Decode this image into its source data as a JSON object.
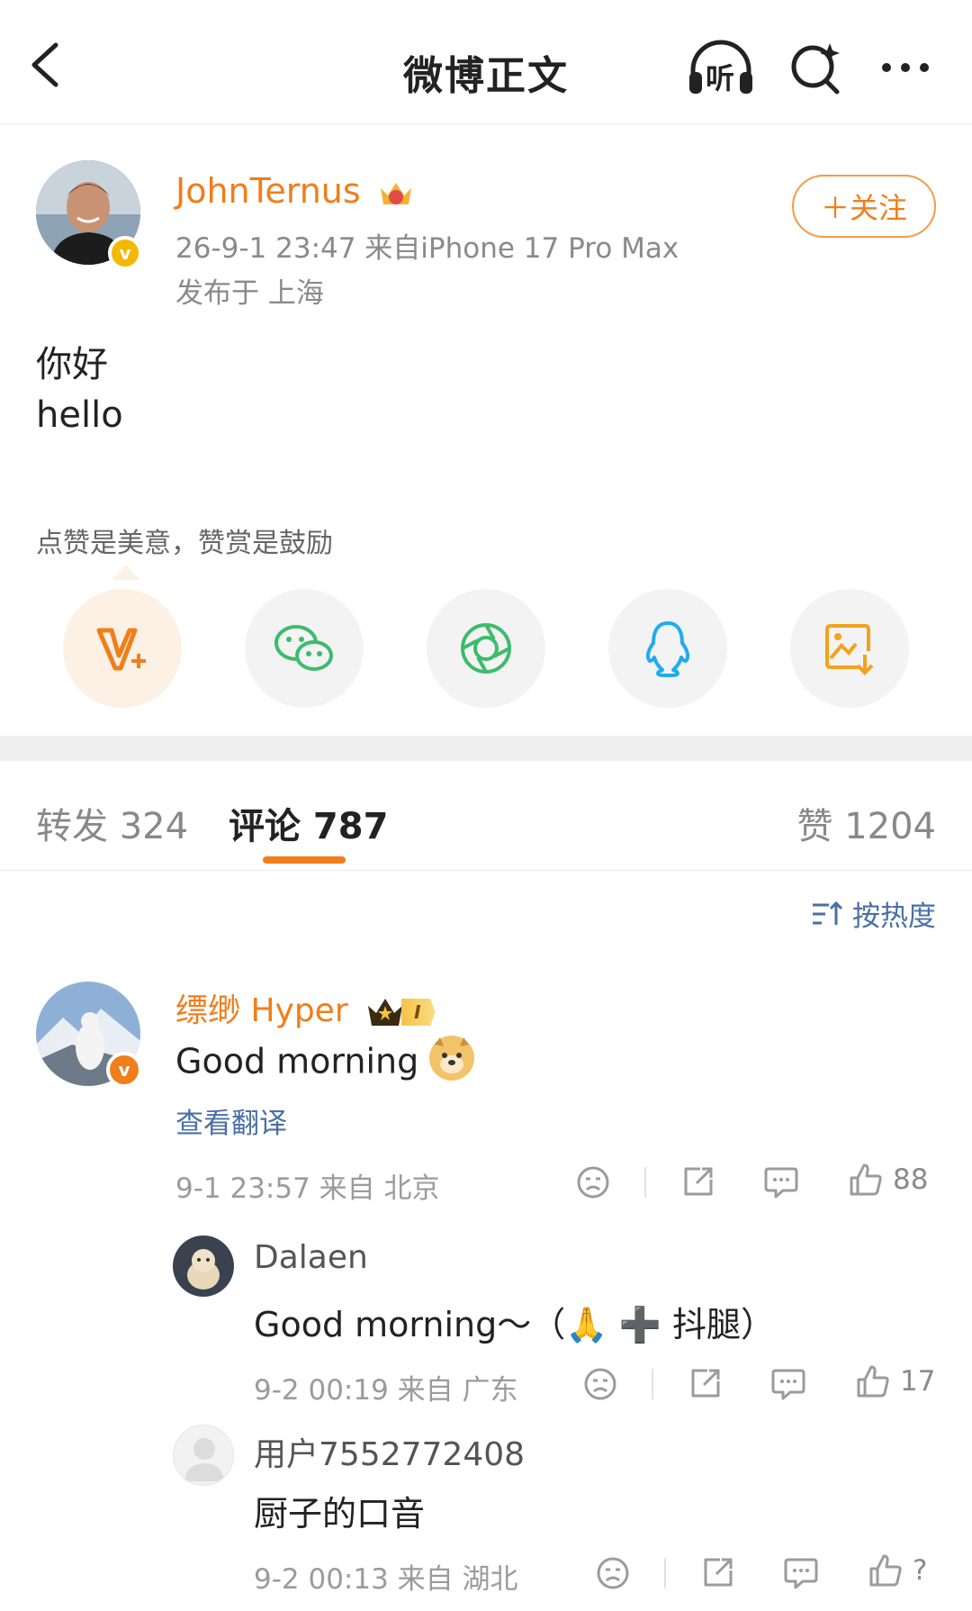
{
  "nav": {
    "title": "微博正文",
    "listen_label": "听"
  },
  "post": {
    "author": "JohnTernus",
    "time_source": "26-9-1 23:47  来自iPhone 17 Pro Max",
    "location": "发布于 上海",
    "follow_label": "＋关注",
    "lines": [
      "你好",
      "hello"
    ],
    "reward_tip": "点赞是美意，赞赏是鼓励"
  },
  "share": {
    "items": [
      "reward-v-plus-icon",
      "wechat-icon",
      "moments-icon",
      "qq-icon",
      "save-image-icon"
    ]
  },
  "tabs": {
    "repost": "转发 324",
    "comment": "评论 787",
    "like": "赞 1204"
  },
  "sort_label": "按热度",
  "comments": [
    {
      "name": "缥缈 Hyper",
      "badge_level": "I",
      "text": "Good morning",
      "translate": "查看翻译",
      "meta": "9-1 23:57  来自 北京",
      "likes": "88"
    },
    {
      "name": "Dalaen",
      "text": "Good morning～（🙏 ➕ 抖腿）",
      "meta": "9-2 00:19  来自 广东",
      "likes": "17"
    },
    {
      "name": "用户7552772408",
      "text": "厨子的口音",
      "meta": "9-2 00:13  来自 湖北",
      "likes": "?"
    }
  ],
  "colors": {
    "accent": "#f07e1a",
    "link": "#4a6fa5",
    "verified": "#f5b800"
  }
}
